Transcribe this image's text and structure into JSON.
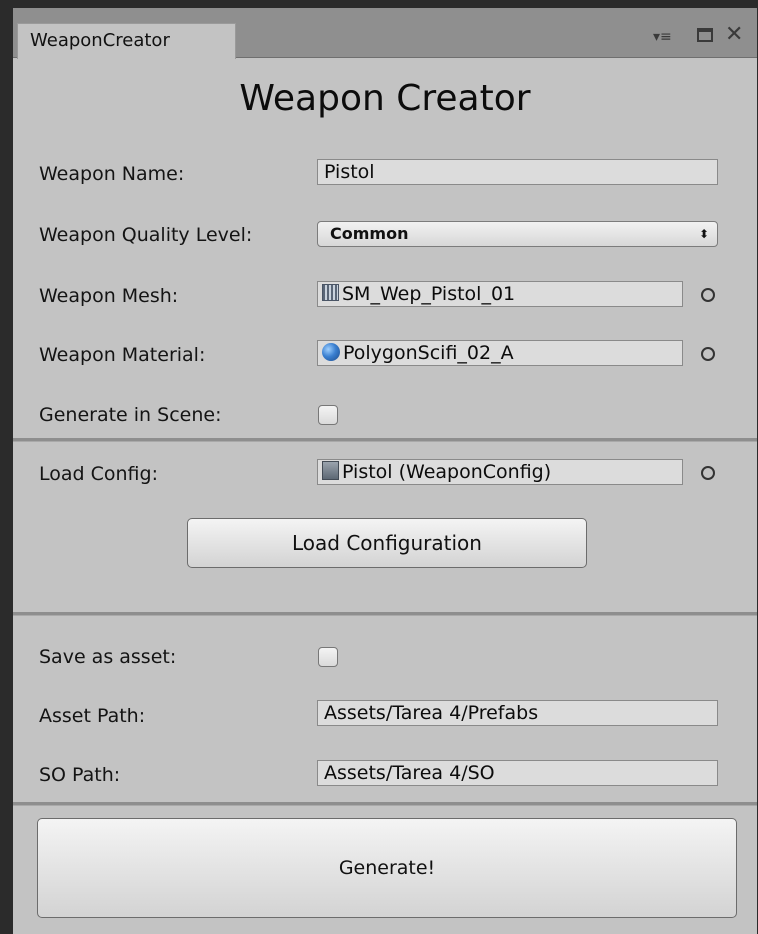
{
  "window": {
    "tab_title": "WeaponCreator",
    "controls": [
      "menu-icon",
      "maximize-icon",
      "close-icon"
    ],
    "menu_glyph": "▾≡",
    "close_glyph": "✕"
  },
  "form": {
    "heading": "Weapon Creator",
    "weapon_name": {
      "label": "Weapon Name:",
      "value": "Pistol"
    },
    "quality": {
      "label": "Weapon Quality Level:",
      "value": "Common",
      "arrow": "⬍"
    },
    "mesh": {
      "label": "Weapon Mesh:",
      "value": "SM_Wep_Pistol_01",
      "icon": "mesh-icon"
    },
    "material": {
      "label": "Weapon Material:",
      "value": "PolygonScifi_02_A",
      "icon": "material-icon"
    },
    "generate_in_scene": {
      "label": "Generate in Scene:",
      "checked": false
    }
  },
  "load": {
    "label": "Load Config:",
    "value": "Pistol (WeaponConfig)",
    "icon": "config-icon",
    "button_label": "Load Configuration"
  },
  "save": {
    "save_as_asset": {
      "label": "Save as asset:",
      "checked": false
    },
    "asset_path": {
      "label": "Asset Path:",
      "value": "Assets/Tarea 4/Prefabs"
    },
    "so_path": {
      "label": "SO Path:",
      "value": "Assets/Tarea 4/SO"
    }
  },
  "generate_button_label": "Generate!",
  "colors": {
    "panel": "#c3c3c3",
    "tabbar": "#8f8f8f",
    "field": "#dcdcdc"
  }
}
